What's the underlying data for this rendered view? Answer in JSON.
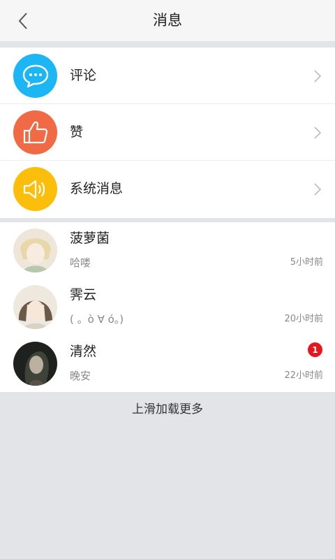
{
  "header": {
    "title": "消息",
    "back_icon": "chevron-left-icon"
  },
  "menu": [
    {
      "label": "评论",
      "icon": "comment-bubble-icon",
      "color": "#1cb6f5"
    },
    {
      "label": "赞",
      "icon": "thumbs-up-icon",
      "color": "#ef6a45"
    },
    {
      "label": "系统消息",
      "icon": "speaker-icon",
      "color": "#fbbf0b"
    }
  ],
  "chats": [
    {
      "name": "菠萝菌",
      "preview": "哈喽",
      "time": "5小时前"
    },
    {
      "name": "霁云",
      "preview": "( 。ò ∀ ó。)",
      "time": "20小时前"
    },
    {
      "name": "清然",
      "preview": "晚安",
      "time": "22小时前",
      "badge": "1"
    }
  ],
  "footer": {
    "load_more": "上滑加载更多"
  },
  "colors": {
    "badge": "#e8171f",
    "background": "#e3e4e8"
  }
}
